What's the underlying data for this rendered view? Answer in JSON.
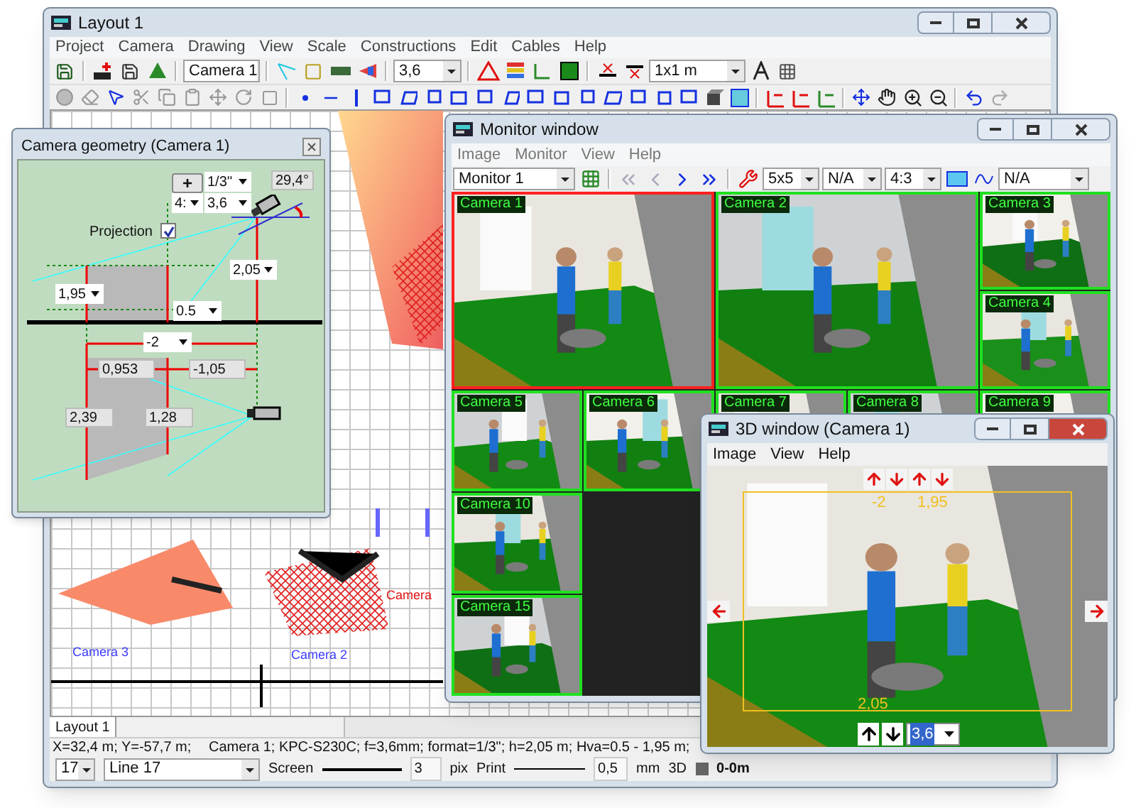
{
  "layout_window": {
    "title": "Layout 1",
    "menu": [
      "Project",
      "Camera",
      "Drawing",
      "View",
      "Scale",
      "Constructions",
      "Edit",
      "Cables",
      "Help"
    ],
    "camera_select": "Camera 1",
    "focal_select": "3,6",
    "grid_select": "1x1 m",
    "plan_labels": [
      {
        "text": "Camera 3",
        "color": "#3b3bff"
      },
      {
        "text": "Camera 2",
        "color": "#3b3bff"
      },
      {
        "text": "Camera",
        "color": "#e01010"
      }
    ],
    "tabs": [
      {
        "label": "Layout 1"
      }
    ],
    "status": {
      "coordinates": "X=32,4 m; Y=-57,7 m;",
      "camera_info": "Camera 1;  KPC-S230C;  f=3,6mm;  format=1/3\";  h=2,05 m; Hva=0.5 - 1,95 m;"
    },
    "line_bar": {
      "width_select": "17",
      "style_select": "Line 17",
      "screen_label": "Screen",
      "screen_value": "3",
      "screen_unit": "pix",
      "print_label": "Print",
      "print_value": "0,5",
      "print_unit": "mm",
      "view_label": "3D",
      "range": "0-0m"
    }
  },
  "geometry_window": {
    "title": "Camera geometry (Camera 1)",
    "controls": [
      {
        "kind": "button",
        "text": "+"
      },
      {
        "kind": "dropdown",
        "text": "1/3''"
      },
      {
        "kind": "readout",
        "text": "29,4°"
      },
      {
        "kind": "dropdown",
        "text": "4:"
      },
      {
        "kind": "dropdown",
        "text": "3,6"
      },
      {
        "kind": "dropdown",
        "text": "2,05"
      },
      {
        "kind": "dropdown",
        "text": "1,95"
      },
      {
        "kind": "dropdown",
        "text": "0.5"
      },
      {
        "kind": "dropdown",
        "text": "-2"
      },
      {
        "kind": "readout",
        "text": "0,953"
      },
      {
        "kind": "readout",
        "text": "-1,05"
      },
      {
        "kind": "readout",
        "text": "2,39"
      },
      {
        "kind": "readout",
        "text": "1,28"
      }
    ],
    "projection": {
      "label": "Projection",
      "checked": true
    }
  },
  "monitor_window": {
    "title": "Monitor window",
    "menu": [
      "Image",
      "Monitor",
      "View",
      "Help"
    ],
    "monitor_select": "Monitor 1",
    "grid_select": "5x5",
    "select_2": "N/A",
    "aspect_select": "4:3",
    "select_4": "N/A",
    "cells": [
      {
        "label": "Camera 1",
        "selected": true
      },
      {
        "label": "Camera 2",
        "selected": false
      },
      {
        "label": "Camera 3",
        "selected": false
      },
      {
        "label": "Camera 4",
        "selected": false
      },
      {
        "label": "Camera 5",
        "selected": false
      },
      {
        "label": "Camera 6",
        "selected": false
      },
      {
        "label": "Camera 7",
        "selected": false
      },
      {
        "label": "Camera 8",
        "selected": false
      },
      {
        "label": "Camera 9",
        "selected": false
      },
      {
        "label": "Camera 10",
        "selected": false
      },
      {
        "label": "Camera 15",
        "selected": false
      }
    ]
  },
  "view3d_window": {
    "title": "3D window (Camera 1)",
    "menu": [
      "Image",
      "View",
      "Help"
    ],
    "tilt_value": "-2",
    "top_value": "1,95",
    "height_value": "2,05",
    "focal_value": "3,6"
  }
}
